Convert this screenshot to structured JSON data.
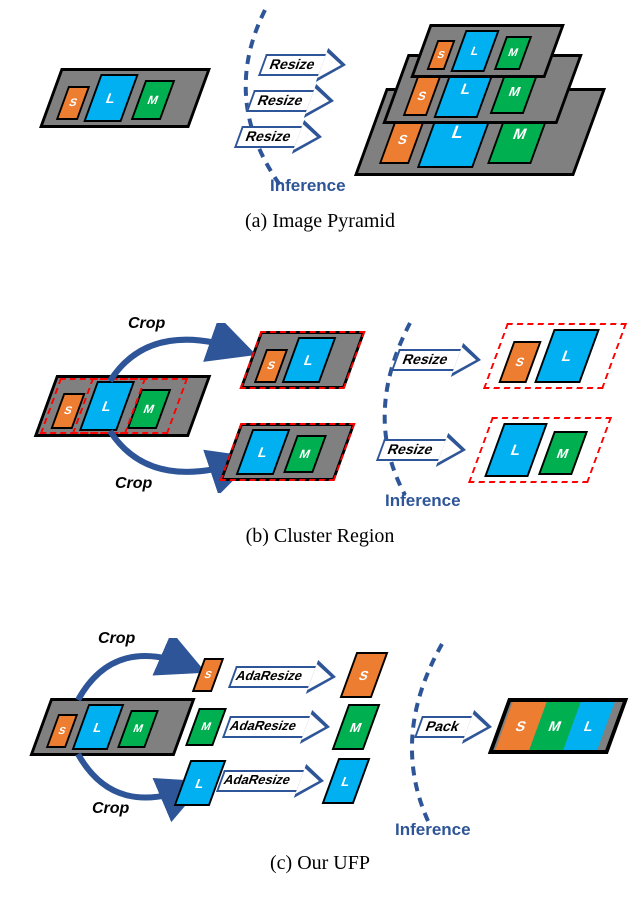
{
  "captions": {
    "a": "(a) Image Pyramid",
    "b": "(b) Cluster Region",
    "c": "(c) Our UFP"
  },
  "labels": {
    "S": "S",
    "L": "L",
    "M": "M",
    "resize": "Resize",
    "adaresize": "AdaResize",
    "pack": "Pack",
    "crop": "Crop",
    "inference": "Inference"
  },
  "chart_data": {
    "type": "diagram",
    "panels": [
      {
        "id": "a",
        "name": "Image Pyramid",
        "flow": "One input slab (S,L,M) -> three Resize arrows -> three stacked output slabs at different scales (each contains S,L,M).",
        "arc_label": "Inference"
      },
      {
        "id": "b",
        "name": "Cluster Region",
        "flow": "Input slab with two dashed-red crop regions -> Crop arrows -> two cropped slabs (S+L and L+M) -> Resize -> two resized dashed-red slabs.",
        "arc_label": "Inference"
      },
      {
        "id": "c",
        "name": "Our UFP",
        "flow": "Input slab (S,L,M) -> Crop -> three individual boxes S,M,L -> AdaResize -> three unified-size boxes -> Pack -> one packed slab containing S,M,L.",
        "arc_label": "Inference"
      }
    ]
  }
}
